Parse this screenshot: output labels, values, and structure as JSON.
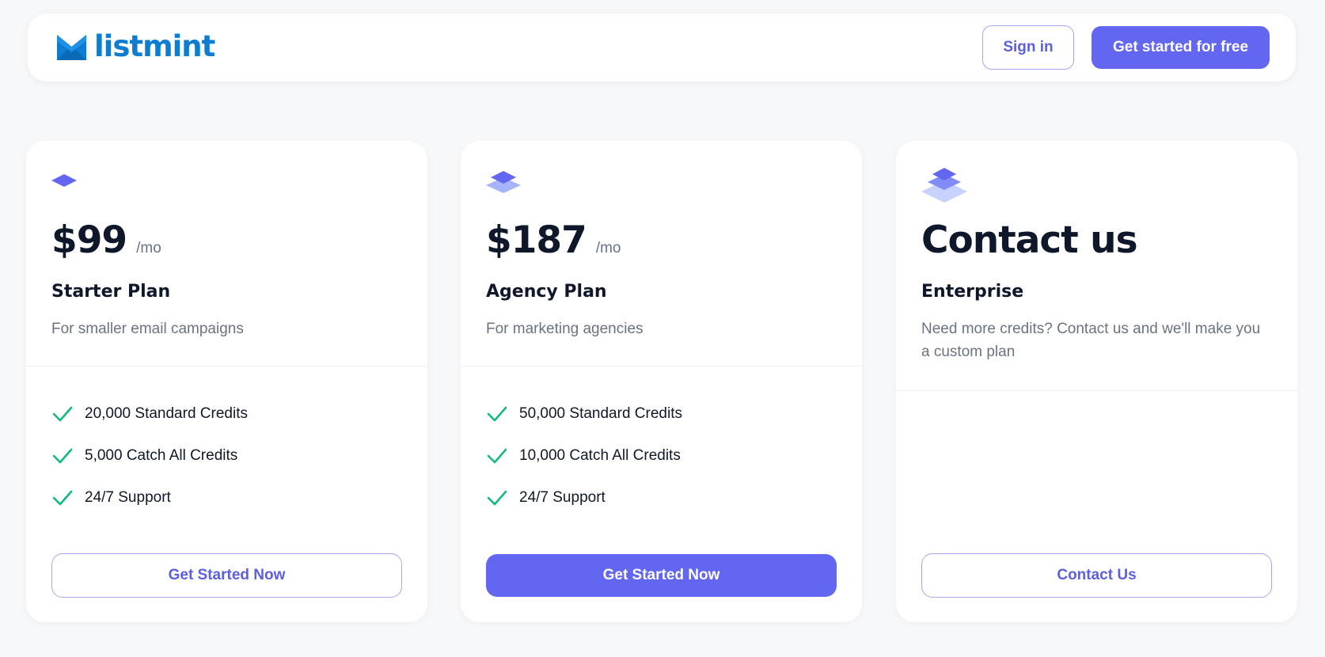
{
  "header": {
    "logo_text": "listmint",
    "signin_label": "Sign in",
    "get_started_label": "Get started for free"
  },
  "colors": {
    "brand_blue": "#0c7dd0",
    "accent": "#6366f1",
    "check": "#10b981",
    "background": "#f7f8fa"
  },
  "plans": [
    {
      "icon": "single-layer-icon",
      "price": "$99",
      "period": "/mo",
      "name": "Starter Plan",
      "description": "For smaller email campaigns",
      "features": [
        "20,000 Standard Credits",
        "5,000 Catch All Credits",
        "24/7 Support"
      ],
      "cta": "Get Started Now"
    },
    {
      "icon": "double-layer-icon",
      "price": "$187",
      "period": "/mo",
      "name": "Agency Plan",
      "description": "For marketing agencies",
      "features": [
        "50,000 Standard Credits",
        "10,000 Catch All Credits",
        "24/7 Support"
      ],
      "cta": "Get Started Now"
    },
    {
      "icon": "triple-layer-icon",
      "price": "Contact us",
      "name": "Enterprise",
      "description": "Need more credits? Contact us and we'll make you a custom plan",
      "features": [],
      "cta": "Contact Us"
    }
  ]
}
